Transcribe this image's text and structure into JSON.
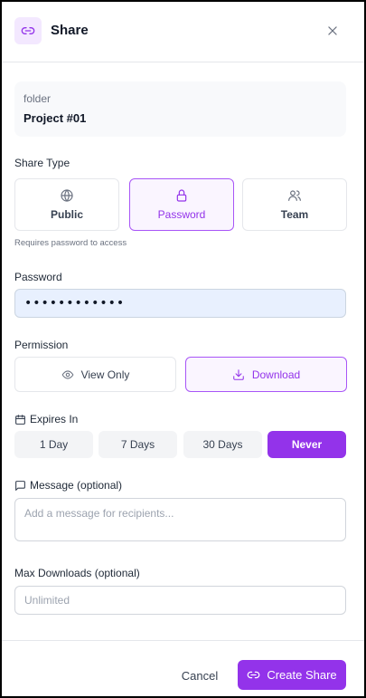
{
  "header": {
    "title": "Share",
    "link_icon": "link-icon",
    "close_icon": "close-icon"
  },
  "folder": {
    "kind": "folder",
    "name": "Project #01"
  },
  "share_type": {
    "label": "Share Type",
    "options": [
      {
        "label": "Public",
        "icon": "globe-icon"
      },
      {
        "label": "Password",
        "icon": "lock-icon",
        "selected": true
      },
      {
        "label": "Team",
        "icon": "users-icon"
      }
    ],
    "hint": "Requires password to access"
  },
  "password": {
    "label": "Password",
    "value": "••••••••••••"
  },
  "permission": {
    "label": "Permission",
    "options": [
      {
        "label": "View Only",
        "icon": "eye-icon"
      },
      {
        "label": "Download",
        "icon": "download-icon",
        "selected": true
      }
    ]
  },
  "expires": {
    "label": "Expires In",
    "icon": "calendar-icon",
    "options": [
      "1 Day",
      "7 Days",
      "30 Days",
      "Never"
    ],
    "selected": "Never"
  },
  "message": {
    "label": "Message (optional)",
    "icon": "message-icon",
    "placeholder": "Add a message for recipients..."
  },
  "max_downloads": {
    "label": "Max Downloads (optional)",
    "placeholder": "Unlimited"
  },
  "footer": {
    "cancel_label": "Cancel",
    "create_label": "Create Share"
  },
  "colors": {
    "accent": "#9333ea",
    "accent_light": "#faf5ff",
    "accent_border": "#a855f7"
  }
}
